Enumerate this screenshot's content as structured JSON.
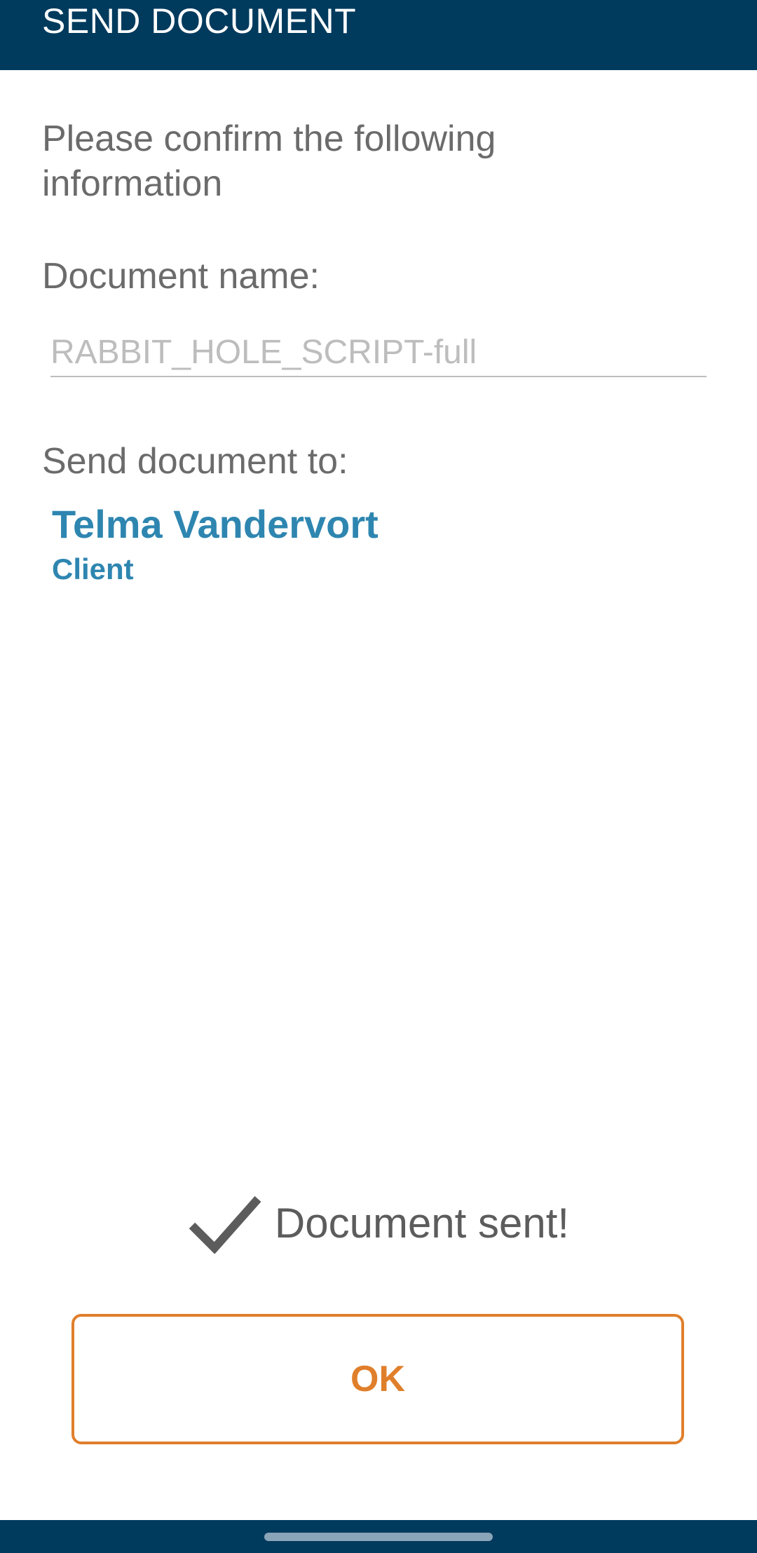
{
  "app_bar": {
    "title": "SEND DOCUMENT"
  },
  "form": {
    "intro": "Please confirm the following information",
    "document_name_label": "Document name:",
    "document_name_value": "RABBIT_HOLE_SCRIPT-full",
    "send_to_label": "Send document to:",
    "recipient": {
      "name": "Telma Vandervort",
      "role": "Client"
    }
  },
  "status": {
    "icon": "check-icon",
    "text": "Document sent!"
  },
  "ok_button": {
    "label": "OK"
  },
  "colors": {
    "app_bar": "#003a5d",
    "recipient": "#2e86b0",
    "accent": "#e07f2b",
    "label_text": "#6b6b6b"
  }
}
